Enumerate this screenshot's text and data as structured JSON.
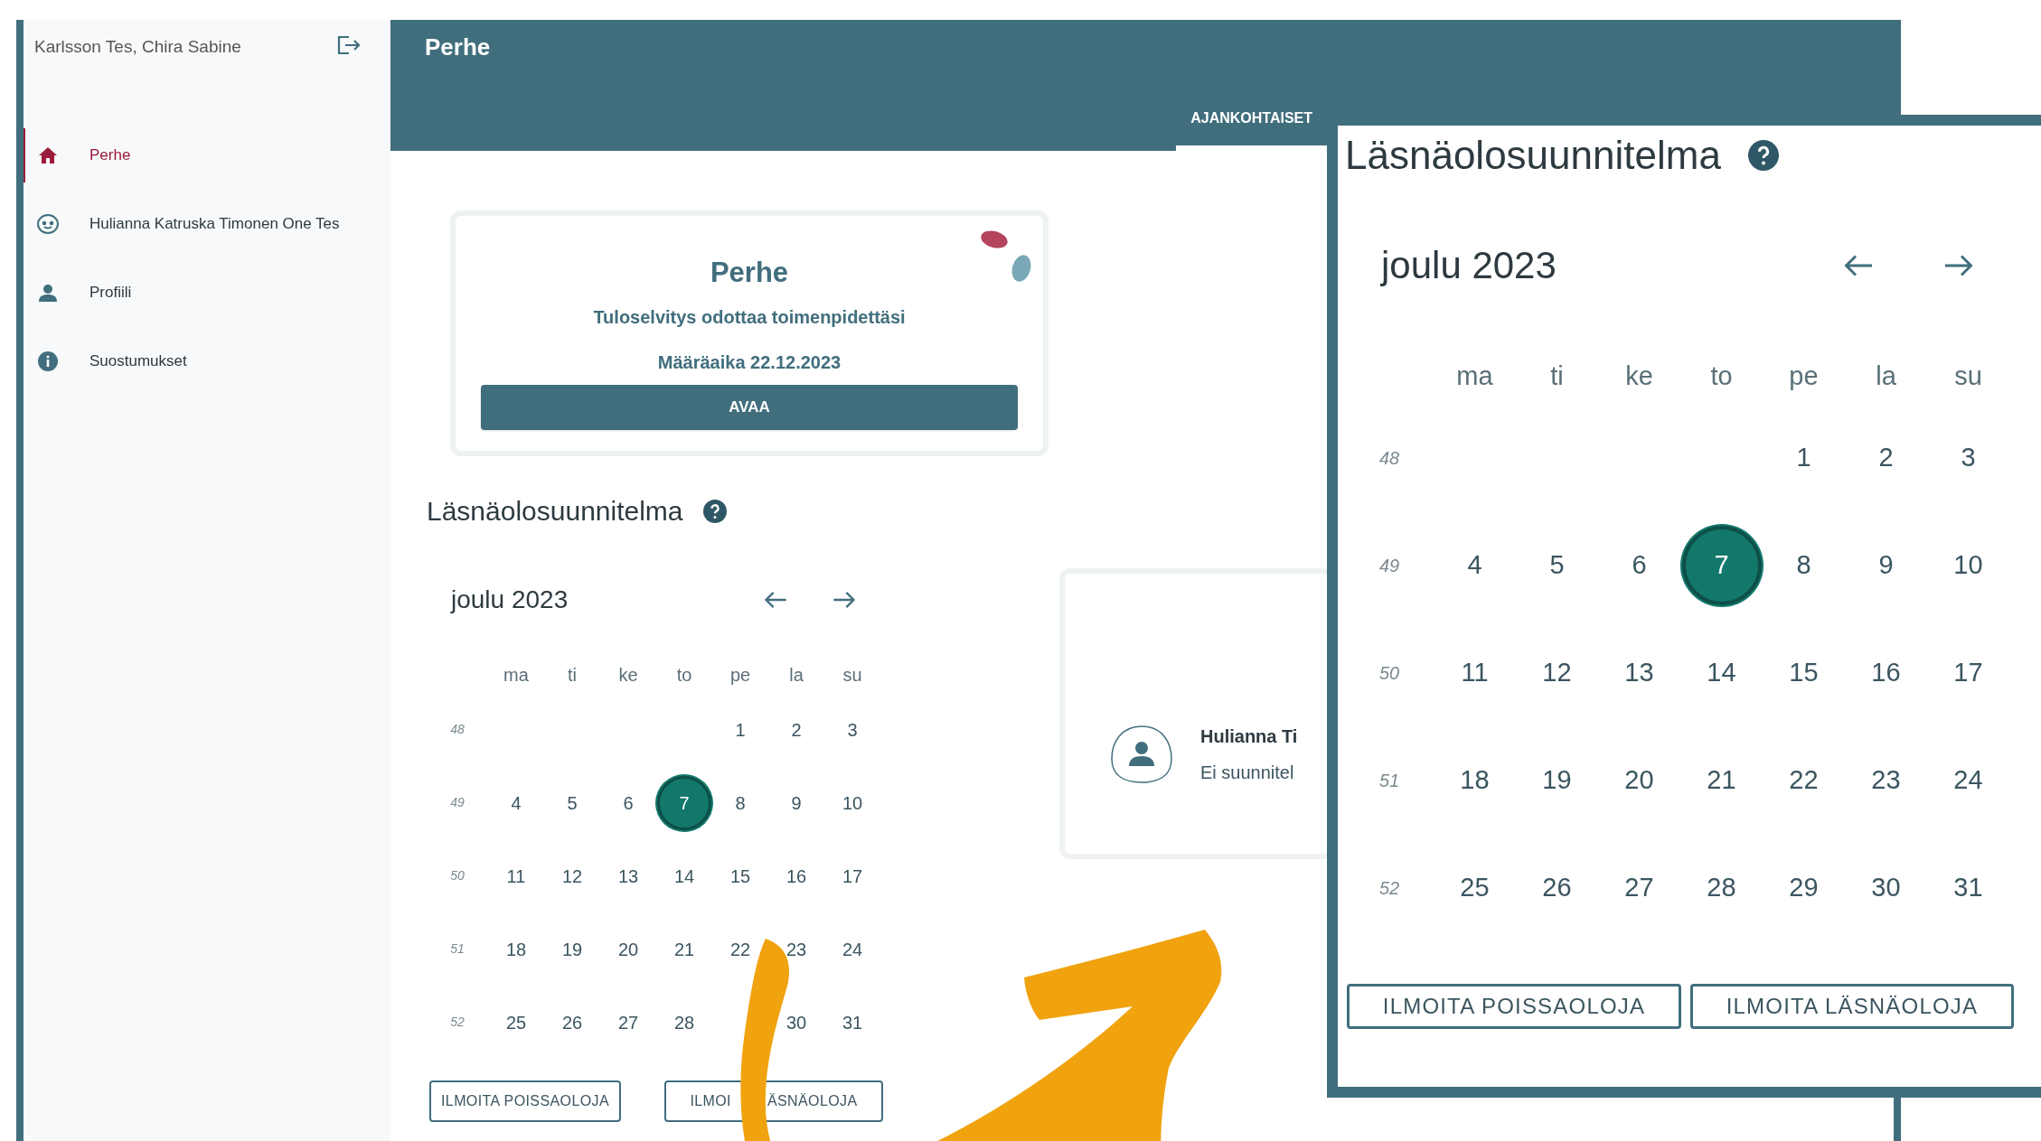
{
  "sidebar": {
    "user_name": "Karlsson Tes, Chira Sabine",
    "items": [
      {
        "label": "Perhe",
        "kind": "home",
        "selected": true
      },
      {
        "label": "Hulianna Katruska Timonen One Tes",
        "kind": "child",
        "selected": false
      },
      {
        "label": "Profiili",
        "kind": "person",
        "selected": false
      },
      {
        "label": "Suostumukset",
        "kind": "info",
        "selected": false
      }
    ]
  },
  "header": {
    "title": "Perhe",
    "tabs": [
      {
        "label": "AJANKOHTAISET",
        "selected": true
      }
    ]
  },
  "notice_card": {
    "title": "Perhe",
    "message": "Tuloselvitys odottaa toimenpidettäsi",
    "deadline": "Määräaika 22.12.2023",
    "button": "AVAA"
  },
  "attendance": {
    "title": "Läsnäolosuunnitelma",
    "month": "joulu 2023",
    "weekdays": [
      "ma",
      "ti",
      "ke",
      "to",
      "pe",
      "la",
      "su"
    ],
    "weeks": [
      {
        "week": "48",
        "days": [
          {
            "kind": "blank"
          },
          {
            "kind": "blank"
          },
          {
            "kind": "blank"
          },
          {
            "kind": "blank"
          },
          {
            "kind": "day",
            "day": "1",
            "selected": false
          },
          {
            "kind": "day",
            "day": "2",
            "selected": false
          },
          {
            "kind": "day",
            "day": "3",
            "selected": false
          }
        ]
      },
      {
        "week": "49",
        "days": [
          {
            "kind": "day",
            "day": "4",
            "selected": false
          },
          {
            "kind": "day",
            "day": "5",
            "selected": false
          },
          {
            "kind": "day",
            "day": "6",
            "selected": false
          },
          {
            "kind": "day",
            "day": "7",
            "selected": true
          },
          {
            "kind": "day",
            "day": "8",
            "selected": false
          },
          {
            "kind": "day",
            "day": "9",
            "selected": false
          },
          {
            "kind": "day",
            "day": "10",
            "selected": false
          }
        ]
      },
      {
        "week": "50",
        "days": [
          {
            "kind": "day",
            "day": "11",
            "selected": false
          },
          {
            "kind": "day",
            "day": "12",
            "selected": false
          },
          {
            "kind": "day",
            "day": "13",
            "selected": false
          },
          {
            "kind": "day",
            "day": "14",
            "selected": false
          },
          {
            "kind": "day",
            "day": "15",
            "selected": false
          },
          {
            "kind": "day",
            "day": "16",
            "selected": false
          },
          {
            "kind": "day",
            "day": "17",
            "selected": false
          }
        ]
      },
      {
        "week": "51",
        "days": [
          {
            "kind": "day",
            "day": "18",
            "selected": false
          },
          {
            "kind": "day",
            "day": "19",
            "selected": false
          },
          {
            "kind": "day",
            "day": "20",
            "selected": false
          },
          {
            "kind": "day",
            "day": "21",
            "selected": false
          },
          {
            "kind": "day",
            "day": "22",
            "selected": false
          },
          {
            "kind": "day",
            "day": "23",
            "selected": false
          },
          {
            "kind": "day",
            "day": "24",
            "selected": false
          }
        ]
      },
      {
        "week": "52",
        "days": [
          {
            "kind": "day",
            "day": "25",
            "selected": false
          },
          {
            "kind": "day",
            "day": "26",
            "selected": false
          },
          {
            "kind": "day",
            "day": "27",
            "selected": false
          },
          {
            "kind": "day",
            "day": "28",
            "selected": false
          },
          {
            "kind": "blank"
          },
          {
            "kind": "day",
            "day": "30",
            "selected": false
          },
          {
            "kind": "day",
            "day": "31",
            "selected": false
          }
        ]
      }
    ],
    "buttons": [
      {
        "label": "ILMOITA POISSAOLOJA"
      },
      {
        "label": "ILMOI",
        "label_end": "ÄSNÄOLOJA"
      }
    ]
  },
  "child_card": {
    "name": "Hulianna Ti",
    "status": "Ei suunnitel"
  },
  "zoomed_panel": {
    "title": "Läsnäolosuunnitelma",
    "month": "joulu 2023",
    "weekdays": [
      "ma",
      "ti",
      "ke",
      "to",
      "pe",
      "la",
      "su"
    ],
    "weeks": [
      {
        "week": "48",
        "days": [
          {
            "kind": "blank"
          },
          {
            "kind": "blank"
          },
          {
            "kind": "blank"
          },
          {
            "kind": "blank"
          },
          {
            "kind": "day",
            "day": "1",
            "selected": false
          },
          {
            "kind": "day",
            "day": "2",
            "selected": false
          },
          {
            "kind": "day",
            "day": "3",
            "selected": false
          }
        ]
      },
      {
        "week": "49",
        "days": [
          {
            "kind": "day",
            "day": "4",
            "selected": false
          },
          {
            "kind": "day",
            "day": "5",
            "selected": false
          },
          {
            "kind": "day",
            "day": "6",
            "selected": false
          },
          {
            "kind": "day",
            "day": "7",
            "selected": true
          },
          {
            "kind": "day",
            "day": "8",
            "selected": false
          },
          {
            "kind": "day",
            "day": "9",
            "selected": false
          },
          {
            "kind": "day",
            "day": "10",
            "selected": false
          }
        ]
      },
      {
        "week": "50",
        "days": [
          {
            "kind": "day",
            "day": "11",
            "selected": false
          },
          {
            "kind": "day",
            "day": "12",
            "selected": false
          },
          {
            "kind": "day",
            "day": "13",
            "selected": false
          },
          {
            "kind": "day",
            "day": "14",
            "selected": false
          },
          {
            "kind": "day",
            "day": "15",
            "selected": false
          },
          {
            "kind": "day",
            "day": "16",
            "selected": false
          },
          {
            "kind": "day",
            "day": "17",
            "selected": false
          }
        ]
      },
      {
        "week": "51",
        "days": [
          {
            "kind": "day",
            "day": "18",
            "selected": false
          },
          {
            "kind": "day",
            "day": "19",
            "selected": false
          },
          {
            "kind": "day",
            "day": "20",
            "selected": false
          },
          {
            "kind": "day",
            "day": "21",
            "selected": false
          },
          {
            "kind": "day",
            "day": "22",
            "selected": false
          },
          {
            "kind": "day",
            "day": "23",
            "selected": false
          },
          {
            "kind": "day",
            "day": "24",
            "selected": false
          }
        ]
      },
      {
        "week": "52",
        "days": [
          {
            "kind": "day",
            "day": "25",
            "selected": false
          },
          {
            "kind": "day",
            "day": "26",
            "selected": false
          },
          {
            "kind": "day",
            "day": "27",
            "selected": false
          },
          {
            "kind": "day",
            "day": "28",
            "selected": false
          },
          {
            "kind": "day",
            "day": "29",
            "selected": false
          },
          {
            "kind": "day",
            "day": "30",
            "selected": false
          },
          {
            "kind": "day",
            "day": "31",
            "selected": false
          }
        ]
      }
    ],
    "buttons": [
      {
        "label": "ILMOITA POISSAOLOJA"
      },
      {
        "label": "ILMOITA LÄSNÄOLOJA"
      }
    ]
  }
}
